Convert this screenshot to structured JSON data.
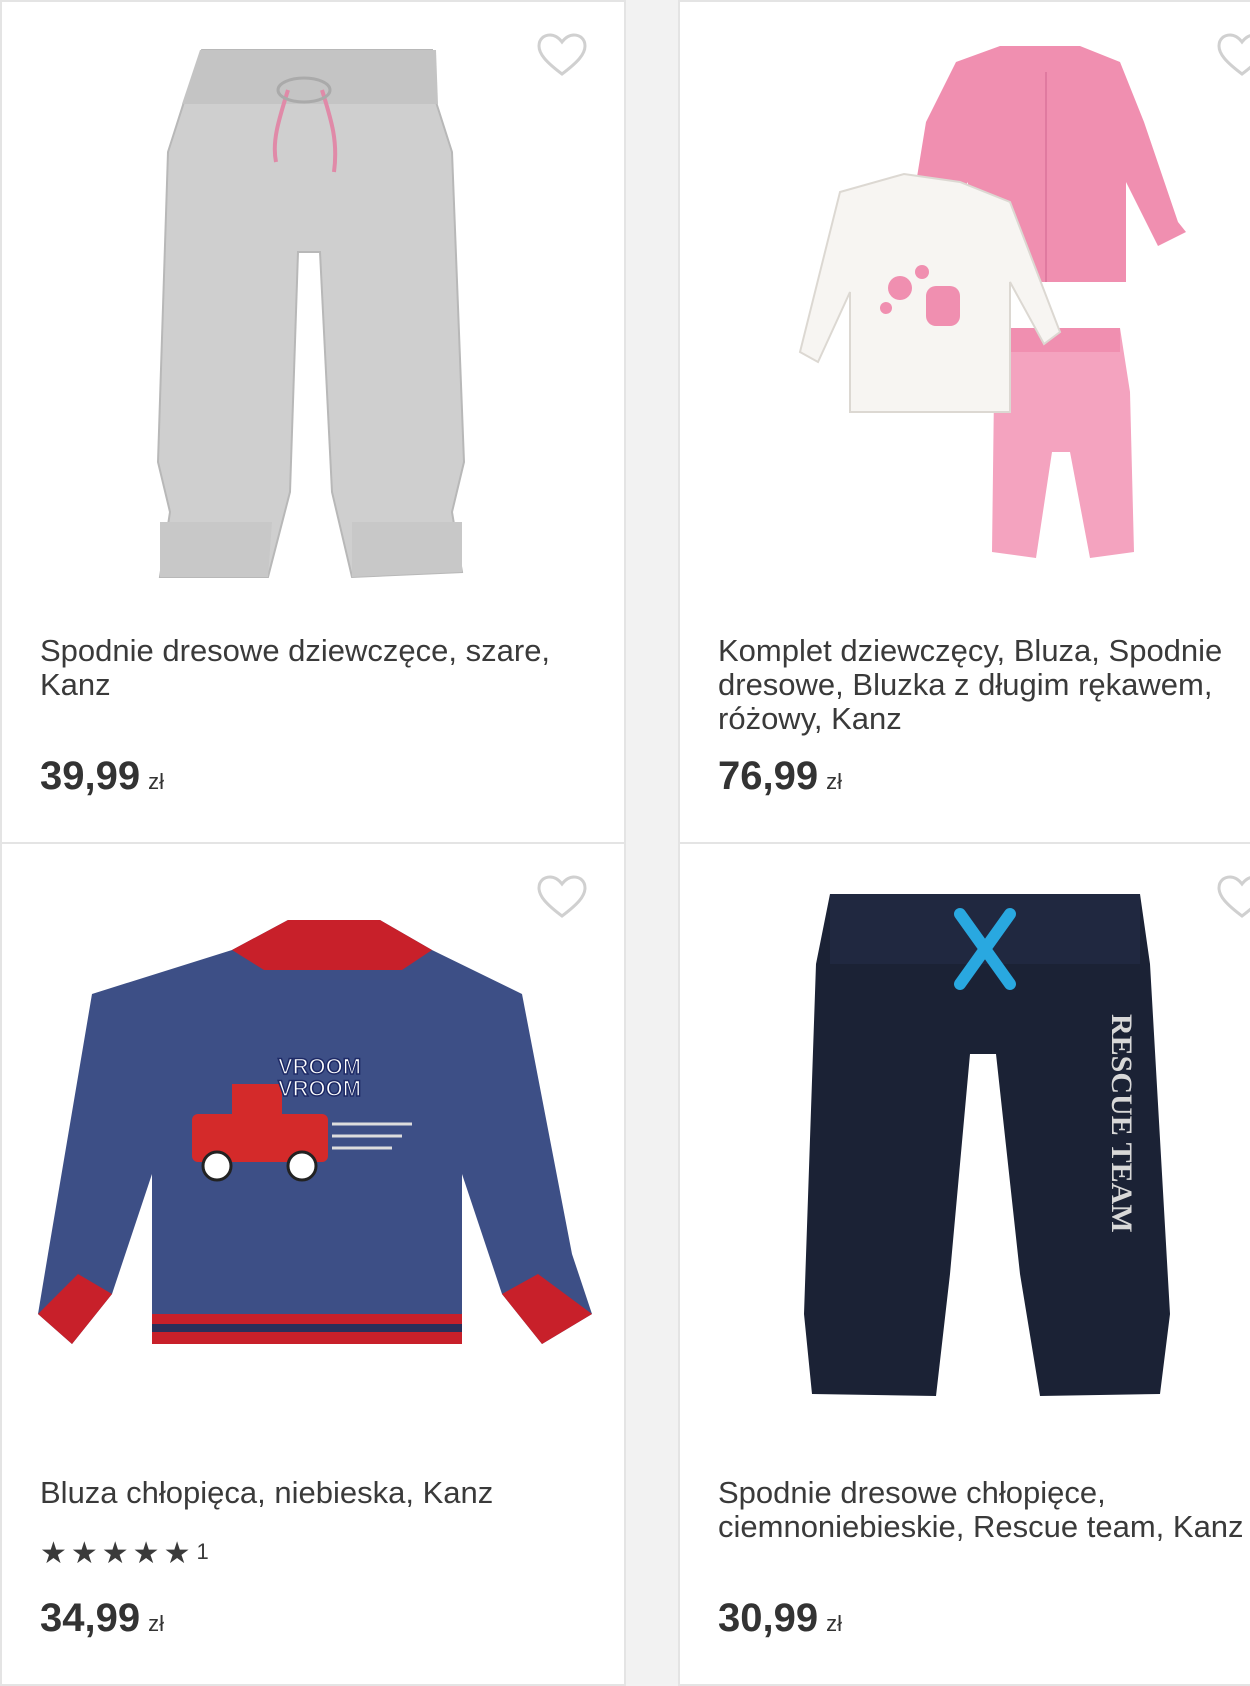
{
  "products": [
    {
      "title": "Spodnie dresowe dziewczęce, szare, Kanz",
      "price": "39,99",
      "currency": "zł",
      "image": "grey-sweatpants"
    },
    {
      "title": "Komplet dziewczęcy, Bluza, Spodnie dresowe, Bluzka z długim rękawem, różowy, Kanz",
      "price": "76,99",
      "currency": "zł",
      "image": "pink-girls-set"
    },
    {
      "title": "Bluza chłopięca, niebieska, Kanz",
      "price": "34,99",
      "currency": "zł",
      "rating_stars": "★★★★★",
      "rating_count": "1",
      "image": "blue-sweatshirt-truck"
    },
    {
      "title": "Spodnie dresowe chłopięce, ciemnoniebieskie, Rescue team, Kanz",
      "price": "30,99",
      "currency": "zł",
      "image": "navy-sweatpants",
      "print_text": "RESCUE TEAM"
    }
  ],
  "truck_print": [
    "VROOM",
    "VROOM"
  ],
  "colors": {
    "card_bg": "#ffffff",
    "page_bg": "#f2f2f2",
    "text": "#333333",
    "heart": "#d0d0d0"
  }
}
